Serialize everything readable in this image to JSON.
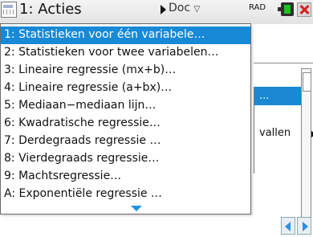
{
  "topbar": {
    "menu_title": "1: Acties",
    "doc_tab": "Doc",
    "doc_chevron": "▽",
    "angle_mode": "RAD",
    "app_icon": "stats-app-icon",
    "battery_color": "#19c41f",
    "close_color": "#d81f1f"
  },
  "background_submenu": {
    "items": [
      {
        "label": "..."
      },
      {
        "label": ""
      },
      {
        "label": "vallen"
      },
      {
        "label": ""
      }
    ]
  },
  "menu": {
    "selected_index": 0,
    "accent": "#1789d6",
    "items": [
      {
        "label": "1: Statistieken voor één variabele…"
      },
      {
        "label": "2: Statistieken voor twee variabelen…"
      },
      {
        "label": "3: Lineaire regressie (mx+b)…"
      },
      {
        "label": "4: Lineaire regressie (a+bx)…"
      },
      {
        "label": "5: Mediaan−mediaan lijn…"
      },
      {
        "label": "6: Kwadratische regressie…"
      },
      {
        "label": "7: Derdegraads regressie …"
      },
      {
        "label": "8: Vierdegraads regressie…"
      },
      {
        "label": "9: Machtsregressie…"
      },
      {
        "label": "A: Exponentiële regressie …"
      }
    ]
  }
}
